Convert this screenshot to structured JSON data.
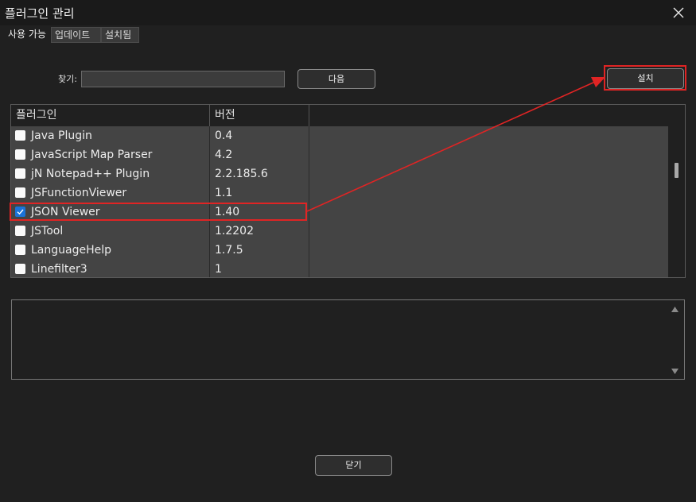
{
  "window": {
    "title": "플러그인 관리"
  },
  "tabs": [
    {
      "label": "사용 가능",
      "active": true
    },
    {
      "label": "업데이트",
      "active": false
    },
    {
      "label": "설치됨",
      "active": false
    }
  ],
  "search": {
    "label": "찾기:",
    "value": "",
    "next_button": "다음"
  },
  "install_button": "설치",
  "list": {
    "columns": [
      "플러그인",
      "버전"
    ],
    "rows": [
      {
        "name": "Java Plugin",
        "version": "0.4",
        "checked": false
      },
      {
        "name": "JavaScript Map Parser",
        "version": "4.2",
        "checked": false
      },
      {
        "name": "jN Notepad++ Plugin",
        "version": "2.2.185.6",
        "checked": false
      },
      {
        "name": "JSFunctionViewer",
        "version": "1.1",
        "checked": false
      },
      {
        "name": "JSON Viewer",
        "version": "1.40",
        "checked": true
      },
      {
        "name": "JSTool",
        "version": "1.2202",
        "checked": false
      },
      {
        "name": "LanguageHelp",
        "version": "1.7.5",
        "checked": false
      },
      {
        "name": "Linefilter3",
        "version": "1",
        "checked": false
      }
    ]
  },
  "description": {
    "text": ""
  },
  "close_button": "닫기",
  "colors": {
    "accent": "#1a73d9",
    "annotation": "#e02424",
    "row_bg": "#444444",
    "window_bg": "#202020"
  }
}
